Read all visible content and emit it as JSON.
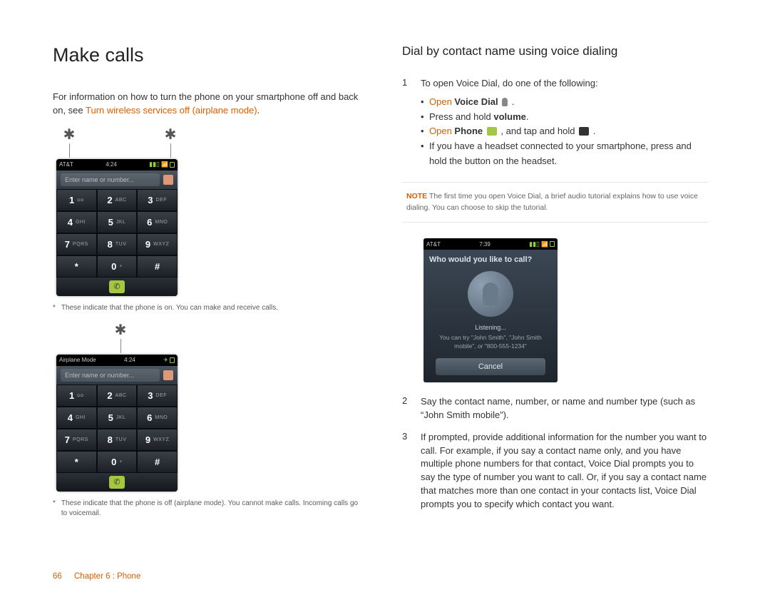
{
  "left": {
    "h1": "Make calls",
    "intro_a": "For information on how to turn the phone on your smartphone off and back on, see ",
    "intro_link": "Turn wireless services off (airplane mode)",
    "intro_b": ".",
    "phone1": {
      "carrier": "AT&T",
      "time": "4:24",
      "search_placeholder": "Enter name or number..."
    },
    "caption1": "These indicate that the phone is on. You can make and receive calls.",
    "phone2": {
      "carrier": "Airplane Mode",
      "time": "4:24",
      "search_placeholder": "Enter name or number..."
    },
    "caption2": "These indicate that the phone is off (airplane mode). You cannot make calls. Incoming calls go to voicemail.",
    "keypad": [
      {
        "n": "1",
        "s": "ᴑᴑ"
      },
      {
        "n": "2",
        "s": "ABC"
      },
      {
        "n": "3",
        "s": "DEF"
      },
      {
        "n": "4",
        "s": "GHI"
      },
      {
        "n": "5",
        "s": "JKL"
      },
      {
        "n": "6",
        "s": "MNO"
      },
      {
        "n": "7",
        "s": "PQRS"
      },
      {
        "n": "8",
        "s": "TUV"
      },
      {
        "n": "9",
        "s": "WXYZ"
      },
      {
        "n": "*",
        "s": ""
      },
      {
        "n": "0",
        "s": "+"
      },
      {
        "n": "#",
        "s": ""
      }
    ]
  },
  "right": {
    "h2": "Dial by contact name using voice dialing",
    "step1_intro": "To open Voice Dial, do one of the following:",
    "bullet_open": "Open",
    "bullet_vd": " Voice Dial",
    "bullet_vd_end": " .",
    "bullet2_a": "Press and hold ",
    "bullet2_b": "volume",
    "bullet2_c": ".",
    "bullet3_phone": " Phone",
    "bullet3_end": " , and tap and hold ",
    "bullet3_end2": " .",
    "bullet4": "If you have a headset connected to your smartphone, press and hold the button on the headset.",
    "note_title": "NOTE",
    "note_text": "  The first time you open Voice Dial, a brief audio tutorial explains how to use voice dialing. You can choose to skip the tutorial.",
    "voice_phone": {
      "carrier": "AT&T",
      "time": "7:39",
      "title": "Who would you like to call?",
      "listening": "Listening...",
      "hint": "You can try \"John Smith\", \"John Smith mobile\", or \"800-555-1234\"",
      "cancel": "Cancel"
    },
    "step2": "Say the contact name, number, or name and number type (such as “John Smith mobile”).",
    "step3": "If prompted, provide additional information for the number you want to call. For example, if you say a contact name only, and you have multiple phone numbers for that contact, Voice Dial prompts you to say the type of number you want to call. Or, if you say a contact name that matches more than one contact in your contacts list, Voice Dial prompts you to specify which contact you want."
  },
  "footer": {
    "page": "66",
    "chapter": "Chapter 6 : Phone"
  }
}
